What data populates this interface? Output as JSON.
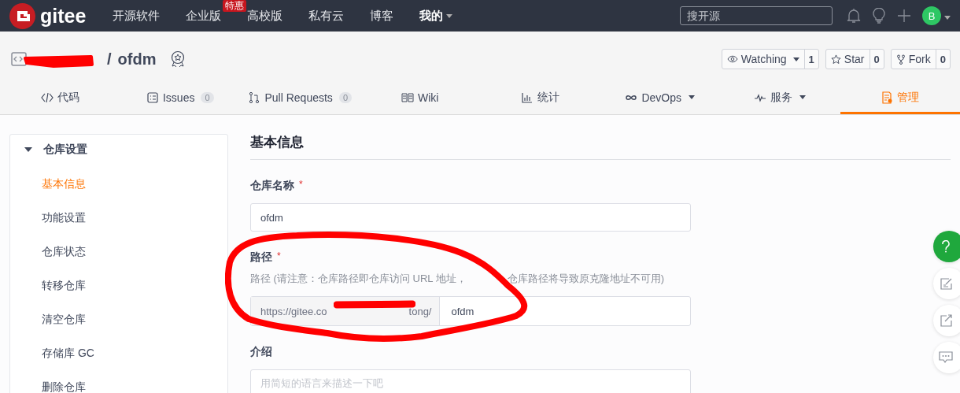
{
  "topbar": {
    "logo": "gitee",
    "nav": [
      {
        "label": "开源软件",
        "dropdown": false
      },
      {
        "label": "企业版",
        "badge": "特惠",
        "dropdown": false
      },
      {
        "label": "高校版",
        "dropdown": false
      },
      {
        "label": "私有云",
        "dropdown": false
      },
      {
        "label": "博客",
        "dropdown": false
      },
      {
        "label": "我的",
        "dropdown": true
      }
    ],
    "search": {
      "placeholder": "搜开源"
    },
    "avatar": "B"
  },
  "repo": {
    "separator": "/",
    "name": "ofdm",
    "actions": [
      {
        "label": "Watching",
        "count": "1",
        "dropdown": true
      },
      {
        "label": "Star",
        "count": "0",
        "dropdown": false
      },
      {
        "label": "Fork",
        "count": "0",
        "dropdown": false
      }
    ]
  },
  "tabs": [
    {
      "label": "代码",
      "selected": false,
      "dropdown": false
    },
    {
      "label": "Issues",
      "count": "0",
      "selected": false,
      "dropdown": false
    },
    {
      "label": "Pull Requests",
      "count": "0",
      "selected": false,
      "dropdown": false
    },
    {
      "label": "Wiki",
      "selected": false,
      "dropdown": false
    },
    {
      "label": "统计",
      "selected": false,
      "dropdown": false
    },
    {
      "label": "DevOps",
      "selected": false,
      "dropdown": true
    },
    {
      "label": "服务",
      "selected": false,
      "dropdown": true
    },
    {
      "label": "管理",
      "selected": true,
      "dropdown": false
    }
  ],
  "sidebar": {
    "group": "仓库设置",
    "expanded": true,
    "items": [
      {
        "label": "基本信息",
        "selected": true
      },
      {
        "label": "功能设置",
        "selected": false
      },
      {
        "label": "仓库状态",
        "selected": false
      },
      {
        "label": "转移仓库",
        "selected": false
      },
      {
        "label": "清空仓库",
        "selected": false
      },
      {
        "label": "存储库 GC",
        "selected": false
      },
      {
        "label": "删除仓库",
        "selected": false
      }
    ]
  },
  "form": {
    "title": "基本信息",
    "required_mark": "*",
    "fields": [
      {
        "kind": "text",
        "label": "仓库名称",
        "required": true,
        "value": "ofdm"
      },
      {
        "kind": "addon",
        "label": "路径",
        "required": true,
        "hint": [
          "路径 (请注意：仓库路径即仓库访问 URL 地址，",
          "仓库路径将导致原克隆地址不可用)"
        ],
        "prefix": [
          "https://gitee.co",
          "tong/"
        ],
        "value": "ofdm"
      },
      {
        "kind": "textarea",
        "label": "介绍",
        "required": false,
        "placeholder": "用简短的语言来描述一下吧"
      }
    ]
  }
}
